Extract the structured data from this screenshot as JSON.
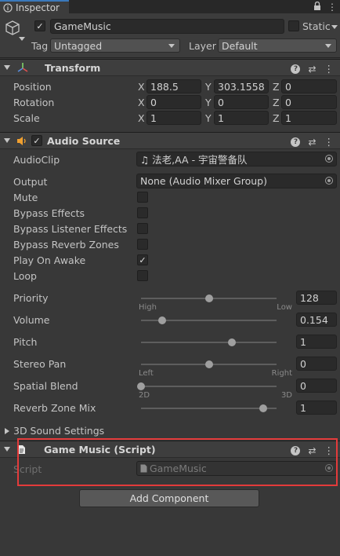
{
  "tab": {
    "label": "Inspector"
  },
  "header": {
    "object_name": "GameMusic",
    "static_label": "Static",
    "tag_label": "Tag",
    "tag_value": "Untagged",
    "layer_label": "Layer",
    "layer_value": "Default"
  },
  "transform": {
    "title": "Transform",
    "rows": [
      {
        "label": "Position",
        "x": "188.5",
        "y": "303.1558",
        "z": "0"
      },
      {
        "label": "Rotation",
        "x": "0",
        "y": "0",
        "z": "0"
      },
      {
        "label": "Scale",
        "x": "1",
        "y": "1",
        "z": "1"
      }
    ],
    "axis": {
      "x": "X",
      "y": "Y",
      "z": "Z"
    }
  },
  "audio": {
    "title": "Audio Source",
    "audioclip_label": "AudioClip",
    "audioclip_value": "♫ 法老,AA - 宇宙警备队",
    "output_label": "Output",
    "output_value": "None (Audio Mixer Group)",
    "mute_label": "Mute",
    "bypass_effects_label": "Bypass Effects",
    "bypass_listener_label": "Bypass Listener Effects",
    "bypass_reverb_label": "Bypass Reverb Zones",
    "play_on_awake_label": "Play On Awake",
    "loop_label": "Loop",
    "check_mark": "✓",
    "priority": {
      "label": "Priority",
      "value": "128",
      "min_label": "High",
      "max_label": "Low",
      "level": 0.5
    },
    "volume": {
      "label": "Volume",
      "value": "0.154",
      "level": 0.154
    },
    "pitch": {
      "label": "Pitch",
      "value": "1",
      "level": 0.67
    },
    "stereo_pan": {
      "label": "Stereo Pan",
      "value": "0",
      "min_label": "Left",
      "max_label": "Right",
      "level": 0.5
    },
    "spatial_blend": {
      "label": "Spatial Blend",
      "value": "0",
      "min_label": "2D",
      "max_label": "3D",
      "level": 0.0
    },
    "reverb_mix": {
      "label": "Reverb Zone Mix",
      "value": "1",
      "level": 0.9
    }
  },
  "sound3d": {
    "label": "3D Sound Settings"
  },
  "script_comp": {
    "title": "Game Music (Script)",
    "script_label": "Script",
    "script_value": "GameMusic"
  },
  "add_component": {
    "label": "Add Component"
  },
  "colors": {
    "highlight": "#e33b3b",
    "accent": "#3a79bb"
  }
}
